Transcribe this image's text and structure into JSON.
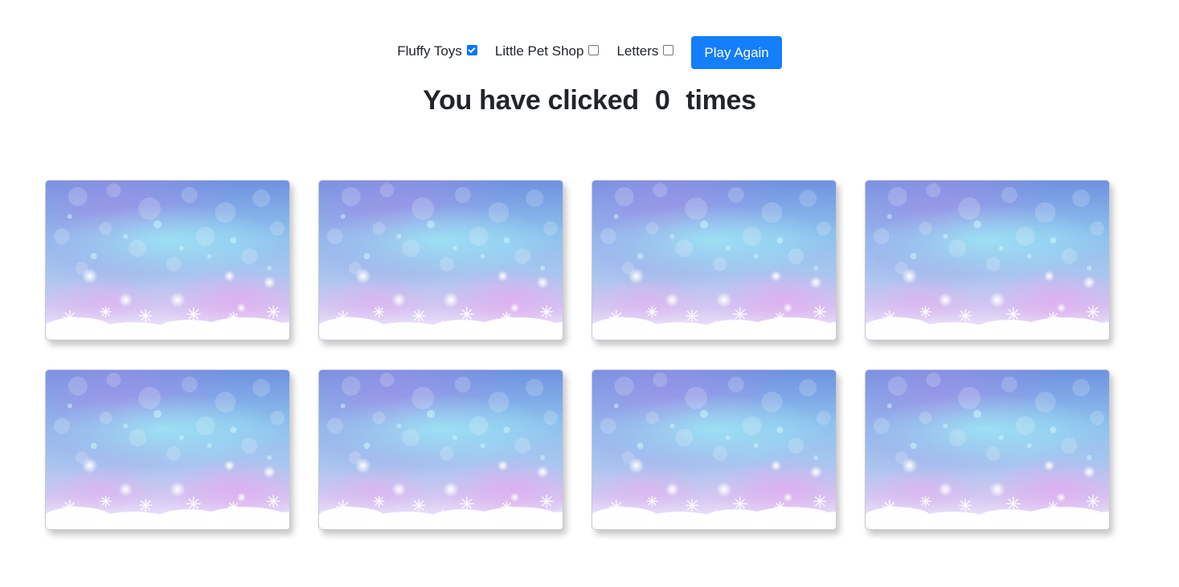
{
  "controls": {
    "options": [
      {
        "label": "Fluffy Toys",
        "checked": true
      },
      {
        "label": "Little Pet Shop",
        "checked": false
      },
      {
        "label": "Letters",
        "checked": false
      }
    ],
    "play_again_label": "Play Again"
  },
  "counter": {
    "prefix": "You have clicked",
    "count": "0",
    "suffix": "times"
  },
  "cards": {
    "count": 8,
    "image": "snowflake-bokeh-background"
  },
  "colors": {
    "button": "#147efb",
    "checkbox_checked": "#0075ff",
    "text": "#212529"
  }
}
